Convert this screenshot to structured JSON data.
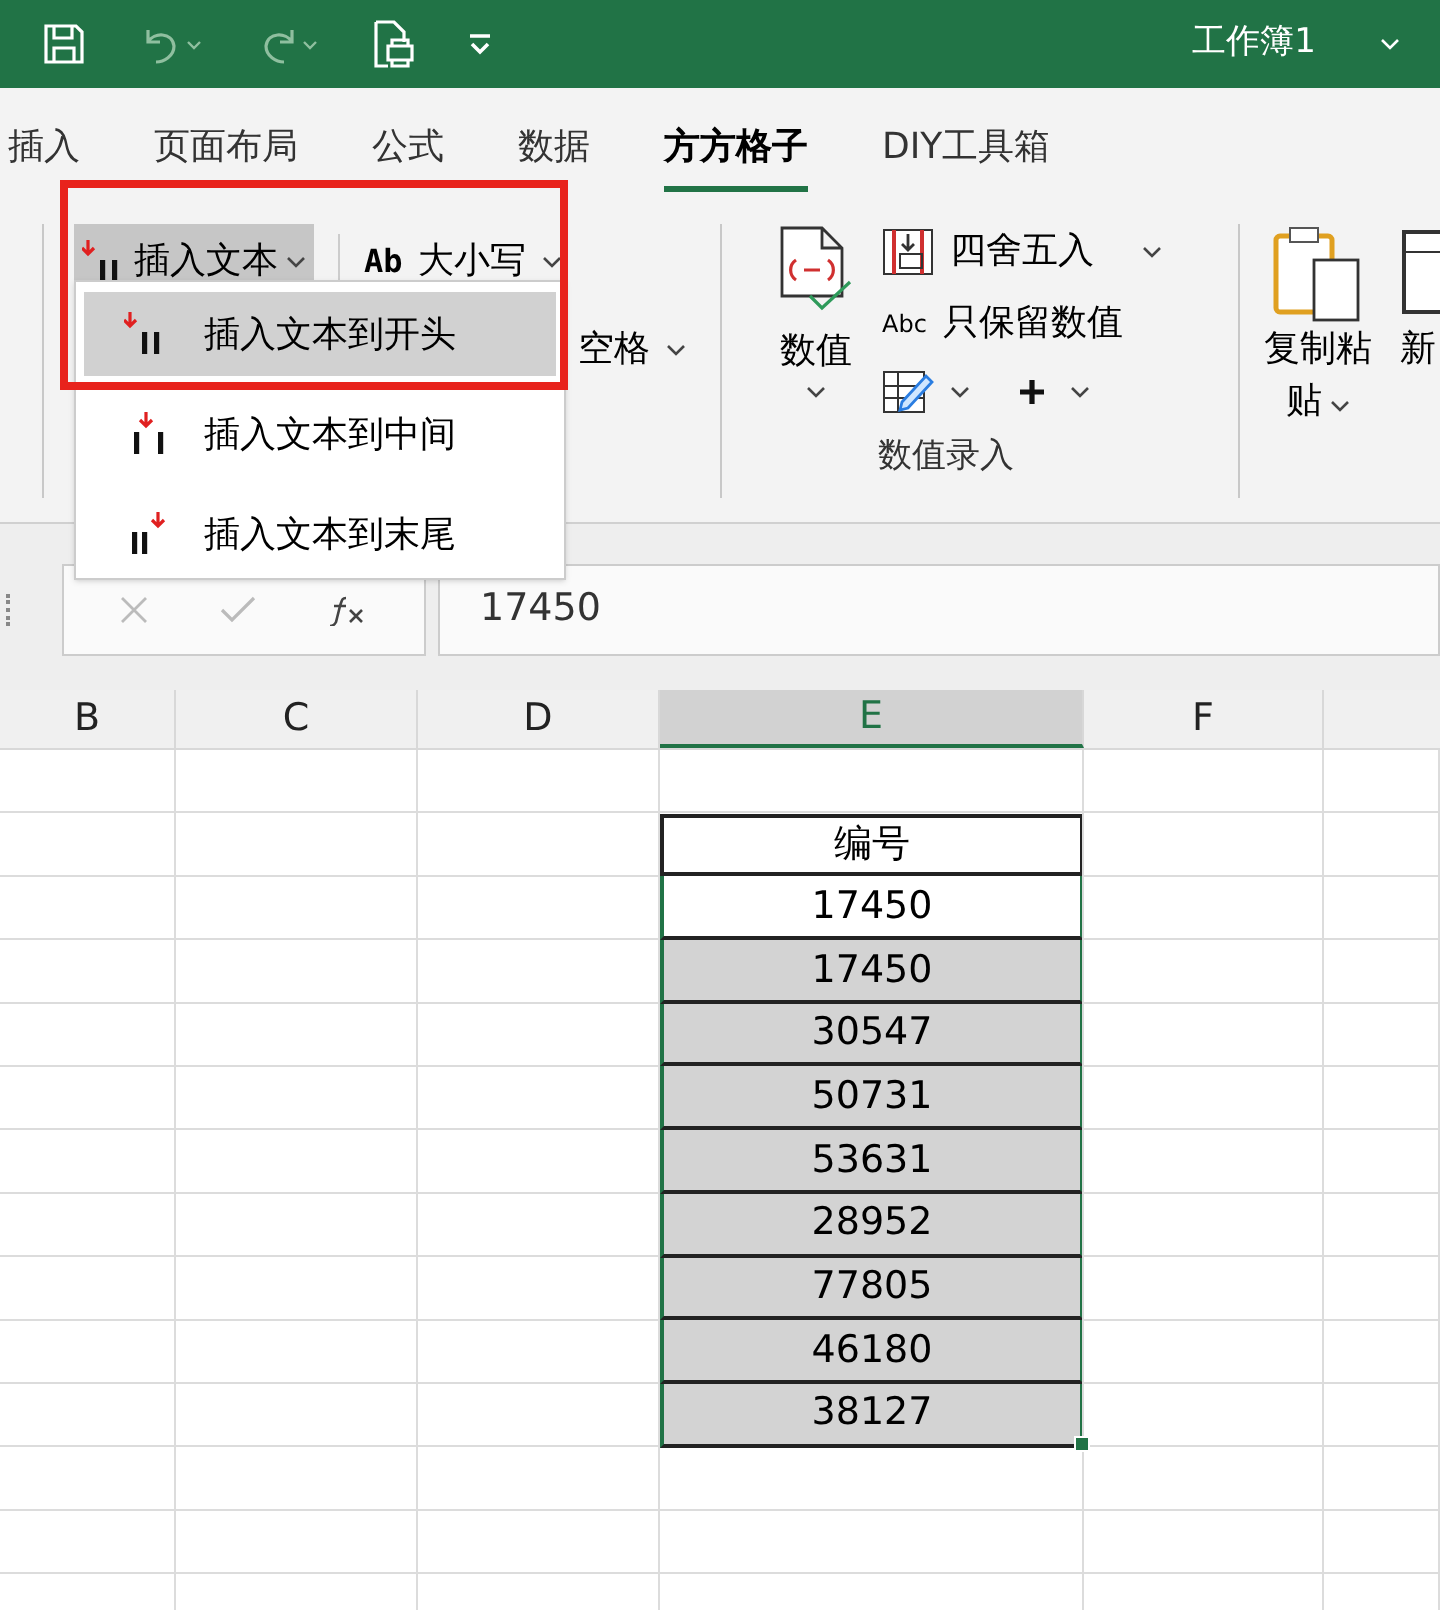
{
  "title_bar": {
    "workbook": "工作簿1"
  },
  "tabs": [
    {
      "label": "插入",
      "selected": false
    },
    {
      "label": "页面布局",
      "selected": false
    },
    {
      "label": "公式",
      "selected": false
    },
    {
      "label": "数据",
      "selected": false
    },
    {
      "label": "方方格子",
      "selected": true
    },
    {
      "label": "DIY工具箱",
      "selected": false
    }
  ],
  "ribbon": {
    "insert_text_button": {
      "label": "插入文本",
      "open": true
    },
    "case_button": {
      "icon_text": "Ab",
      "label": "大小写"
    },
    "space_button": "空格",
    "value_button": "数值",
    "round_button": "四舍五入",
    "keep_values_button": {
      "icon_text": "Abc",
      "label": "只保留数值"
    },
    "value_group_label": "数值录入",
    "paste_button": "复制粘贴",
    "new_button": "新"
  },
  "menu": [
    {
      "label": "插入文本到开头",
      "kind": "start",
      "selected": true
    },
    {
      "label": "插入文本到中间",
      "kind": "middle",
      "selected": false
    },
    {
      "label": "插入文本到末尾",
      "kind": "end",
      "selected": false
    }
  ],
  "formula_bar": {
    "value": "17450"
  },
  "columns": [
    {
      "label": "B",
      "selected": false
    },
    {
      "label": "C",
      "selected": false
    },
    {
      "label": "D",
      "selected": false
    },
    {
      "label": "E",
      "selected": true
    },
    {
      "label": "F",
      "selected": false
    }
  ],
  "sheet": {
    "header": "编号",
    "cells": [
      {
        "value": "17450",
        "active": true
      },
      {
        "value": "17450",
        "active": false
      },
      {
        "value": "30547",
        "active": false
      },
      {
        "value": "50731",
        "active": false
      },
      {
        "value": "53631",
        "active": false
      },
      {
        "value": "28952",
        "active": false
      },
      {
        "value": "77805",
        "active": false
      },
      {
        "value": "46180",
        "active": false
      },
      {
        "value": "38127",
        "active": false
      }
    ]
  }
}
